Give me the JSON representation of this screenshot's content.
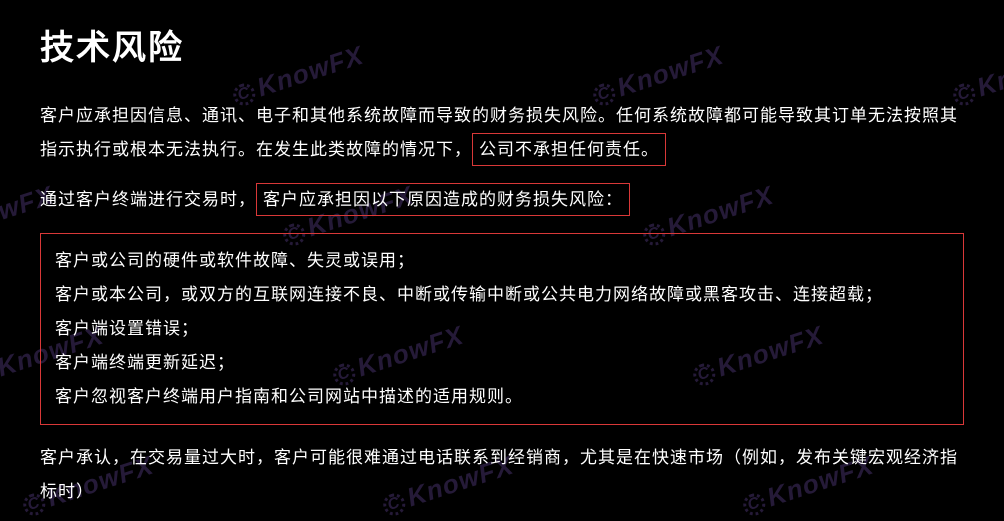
{
  "watermark": "KnowFX",
  "title": "技术风险",
  "para1_a": "客户应承担因信息、通讯、电子和其他系统故障而导致的财务损失风险。任何系统故障都可能导致其订单无法按照其指示执行或根本无法执行。在发生此类故障的情况下，",
  "para1_hl": "公司不承担任何责任。",
  "para2_a": "通过客户终端进行交易时，",
  "para2_hl": "客户应承担因以下原因造成的财务损失风险：",
  "list": [
    "客户或公司的硬件或软件故障、失灵或误用；",
    "客户或本公司，或双方的互联网连接不良、中断或传输中断或公共电力网络故障或黑客攻击、连接超载；",
    "客户端设置错误；",
    "客户端终端更新延迟；",
    "客户忽视客户终端用户指南和公司网站中描述的适用规则。"
  ],
  "para3": "客户承认，在交易量过大时，客户可能很难通过电话联系到经销商，尤其是在快速市场（例如，发布关键宏观经济指标时）"
}
